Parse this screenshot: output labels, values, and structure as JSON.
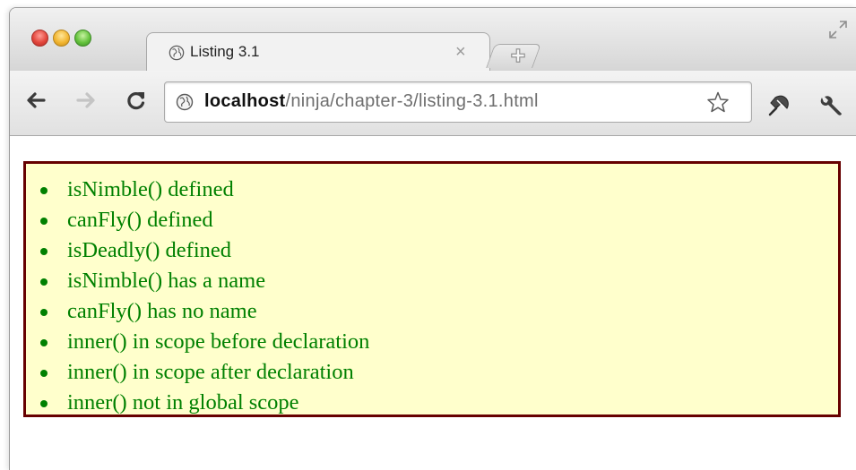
{
  "tab": {
    "title": "Listing 3.1",
    "close_glyph": "×"
  },
  "address_bar": {
    "host": "localhost",
    "path": "/ninja/chapter-3/listing-3.1.html"
  },
  "results": [
    "isNimble() defined",
    "canFly() defined",
    "isDeadly() defined",
    "isNimble() has a name",
    "canFly() has no name",
    "inner() in scope before declaration",
    "inner() in scope after declaration",
    "inner() not in global scope"
  ],
  "colors": {
    "pass_text": "#008000",
    "results_background": "#ffffcc",
    "results_border": "#660000"
  },
  "icons": {
    "tab_favicon": "globe-icon",
    "new_tab": "new-tab-icon",
    "fullscreen": "fullscreen-icon",
    "back": "back-arrow-icon",
    "forward": "forward-arrow-icon",
    "reload": "reload-icon",
    "site_info": "globe-icon",
    "bookmark": "star-icon",
    "extension": "extension-icon",
    "settings": "wrench-icon"
  }
}
